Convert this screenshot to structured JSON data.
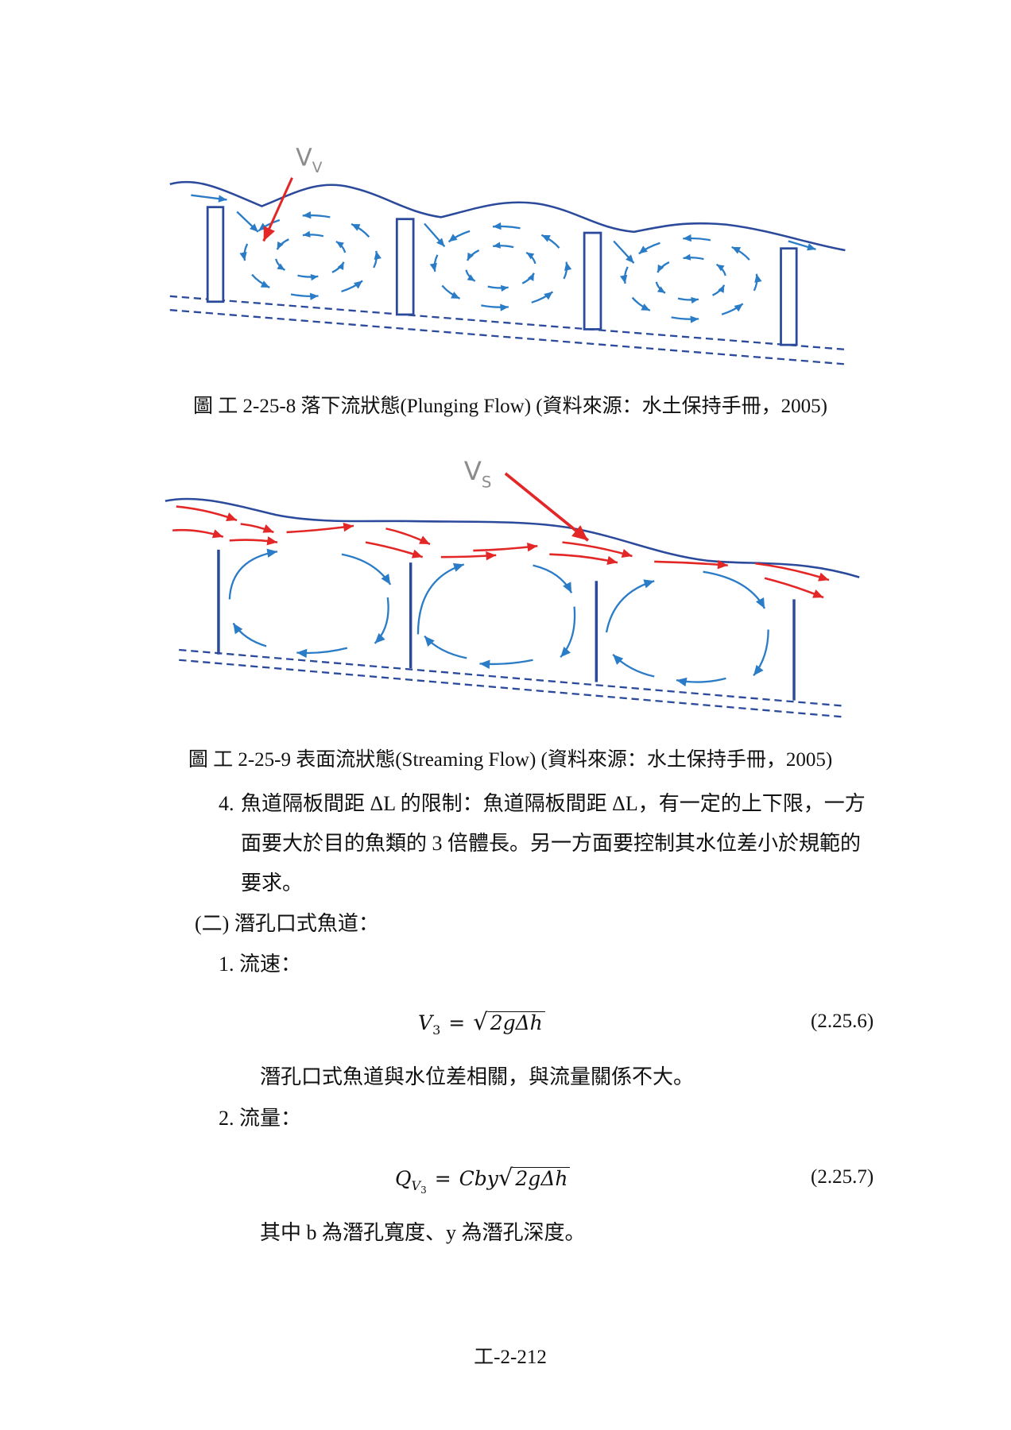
{
  "colors": {
    "water_line": "#2b4a9b",
    "baffle": "#2b4a9b",
    "bed_line": "#2b4a9b",
    "flow_arrow": "#2b7cc7",
    "surface_arrow": "#e32626",
    "velocity_arrow": "#e32626",
    "velocity_label": "#8c8c8c"
  },
  "figures": [
    {
      "velocity_label": {
        "symbol": "V",
        "subscript": "V"
      },
      "caption": "圖 工 2-25-8 落下流狀態(Plunging Flow) (資料來源：水土保持手冊，2005)"
    },
    {
      "velocity_label": {
        "symbol": "V",
        "subscript": "S"
      },
      "caption": "圖 工 2-25-9 表面流狀態(Streaming Flow) (資料來源：水土保持手冊，2005)"
    }
  ],
  "item_4": {
    "number": "4.",
    "lines": [
      "魚道隔板間距 ΔL 的限制：魚道隔板間距 ΔL，有一定的上下限，一方",
      "面要大於目的魚類的 3 倍體長。另一方面要控制其水位差小於規範的",
      "要求。"
    ]
  },
  "section_2": {
    "heading": "(二) 潛孔口式魚道：",
    "subsection_1": {
      "heading": "1. 流速：",
      "equation": {
        "lhs": "V",
        "lhs_sub": "3",
        "equals": "=",
        "radical": "√",
        "radicand": "2gΔh",
        "number": "(2.25.6)"
      },
      "note": "潛孔口式魚道與水位差相關，與流量關係不大。"
    },
    "subsection_2": {
      "heading": "2. 流量：",
      "equation": {
        "lhs": "Q",
        "lhs_sub": "V",
        "lhs_subsub": "3",
        "equals": "=",
        "coefficient": "Cby",
        "radical": "√",
        "radicand": "2gΔh",
        "number": "(2.25.7)"
      },
      "note": "其中 b 為潛孔寬度、y 為潛孔深度。"
    }
  },
  "page_number": "工-2-212"
}
